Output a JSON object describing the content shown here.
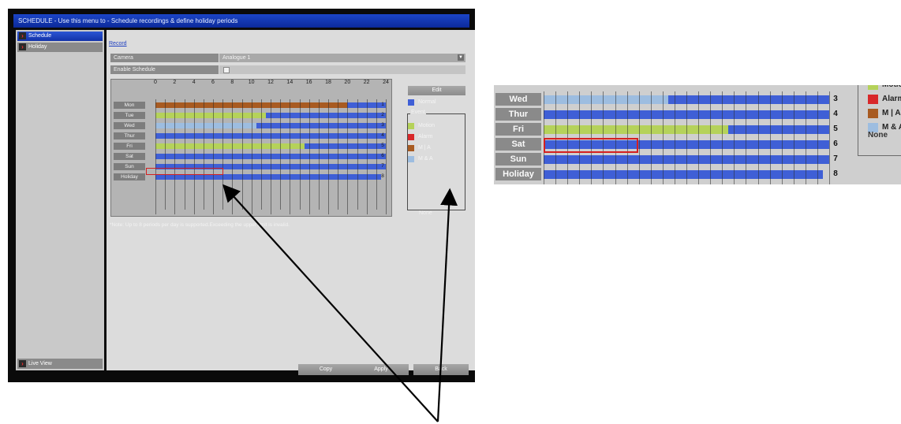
{
  "window": {
    "title": "SCHEDULE - Use this menu to - Schedule recordings & define holiday periods"
  },
  "sidebar": {
    "items": [
      {
        "label": "Schedule",
        "active": true
      },
      {
        "label": "Holiday",
        "active": false
      }
    ],
    "bottom_label": "Live View"
  },
  "tabs": {
    "record": "Record"
  },
  "camera": {
    "label": "Camera",
    "value": "Analogue 1"
  },
  "enable_schedule": {
    "label": "Enable Schedule",
    "checked": false
  },
  "grid": {
    "hour_ticks": [
      "0",
      "2",
      "4",
      "6",
      "8",
      "10",
      "12",
      "14",
      "16",
      "18",
      "20",
      "22",
      "24"
    ],
    "days": [
      {
        "name": "Mon",
        "num": "1",
        "segments": [
          {
            "from": 0,
            "to": 20,
            "type": "M | A"
          },
          {
            "from": 20,
            "to": 24,
            "type": "Normal"
          }
        ]
      },
      {
        "name": "Tue",
        "num": "2",
        "segments": [
          {
            "from": 0,
            "to": 11.5,
            "type": "Motion"
          },
          {
            "from": 11.5,
            "to": 24,
            "type": "Normal"
          }
        ]
      },
      {
        "name": "Wed",
        "num": "3",
        "segments": [
          {
            "from": 0,
            "to": 10.5,
            "type": "M & A"
          },
          {
            "from": 10.5,
            "to": 24,
            "type": "Normal"
          }
        ]
      },
      {
        "name": "Thur",
        "num": "4",
        "segments": [
          {
            "from": 0,
            "to": 24,
            "type": "Normal"
          }
        ]
      },
      {
        "name": "Fri",
        "num": "5",
        "segments": [
          {
            "from": 0,
            "to": 15.5,
            "type": "Motion"
          },
          {
            "from": 15.5,
            "to": 24,
            "type": "Normal"
          }
        ]
      },
      {
        "name": "Sat",
        "num": "6",
        "segments": [
          {
            "from": 0,
            "to": 24,
            "type": "Normal"
          }
        ]
      },
      {
        "name": "Sun",
        "num": "7",
        "segments": [
          {
            "from": 0,
            "to": 24,
            "type": "Normal"
          }
        ]
      },
      {
        "name": "Holiday",
        "num": "8",
        "segments": [
          {
            "from": 0,
            "to": 23.5,
            "type": "Normal"
          }
        ]
      }
    ],
    "selected_day": "Sat"
  },
  "legend": {
    "edit_label": "Edit",
    "normal": "Normal",
    "event_title": "Event",
    "items": [
      {
        "label": "Motion",
        "color": "#b5d25a"
      },
      {
        "label": "Alarm",
        "color": "#d8282a"
      },
      {
        "label": "M | A",
        "color": "#a85b22"
      },
      {
        "label": "M & A",
        "color": "#9dbde0"
      }
    ],
    "none": "None"
  },
  "colors": {
    "Normal": "#3f5fd6",
    "Motion": "#b5d25a",
    "Alarm": "#d8282a",
    "M | A": "#a85b22",
    "M & A": "#9dbde0"
  },
  "note": "*Note: Up to 8 periods per day is supported.Exceeding the upper limit is invalid.",
  "buttons": {
    "copy": "Copy",
    "apply": "Apply",
    "back": "Back"
  },
  "inset": {
    "days": [
      {
        "name": "Wed",
        "num": "3"
      },
      {
        "name": "Thur",
        "num": "4"
      },
      {
        "name": "Fri",
        "num": "5"
      },
      {
        "name": "Sat",
        "num": "6"
      },
      {
        "name": "Sun",
        "num": "7"
      },
      {
        "name": "Holiday",
        "num": "8"
      }
    ],
    "legend": [
      {
        "label": "Motion",
        "color": "#b5d25a"
      },
      {
        "label": "Alarm",
        "color": "#d8282a"
      },
      {
        "label": "M | A",
        "color": "#a85b22"
      },
      {
        "label": "M & A",
        "color": "#9dbde0"
      }
    ],
    "none": "None"
  }
}
